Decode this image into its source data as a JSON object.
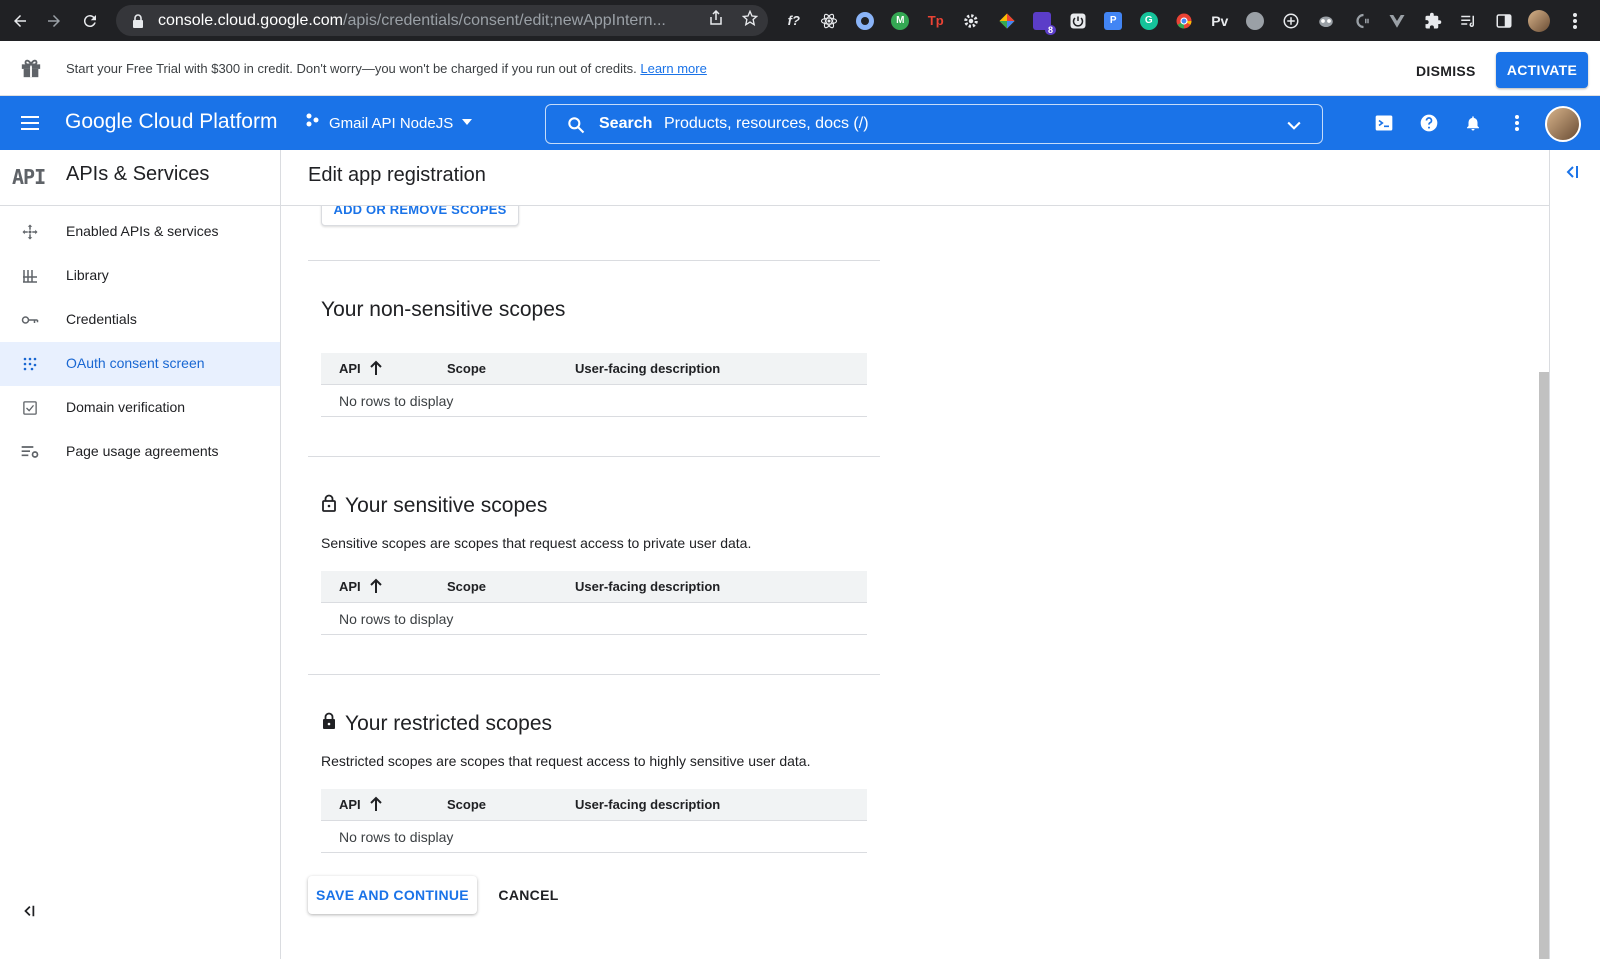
{
  "browser": {
    "url_host": "console.cloud.google.com",
    "url_path": "/apis/credentials/consent/edit;newAppIntern...",
    "extension_badge": "8",
    "ext_labels": {
      "f": "f?",
      "tp": "Tp",
      "pv": "Pv",
      "p": "P",
      "g": "G"
    }
  },
  "trial_banner": {
    "message": "Start your Free Trial with $300 in credit. Don't worry—you won't be charged if you run out of credits.",
    "learn_more": "Learn more",
    "dismiss": "DISMISS",
    "activate": "ACTIVATE"
  },
  "header": {
    "title": "Google Cloud Platform",
    "project": "Gmail API NodeJS",
    "search_label": "Search",
    "search_placeholder": "Products, resources, docs (/)",
    "brand_color": "#1a73e8"
  },
  "sidebar": {
    "logo": "API",
    "title": "APIs & Services",
    "items": [
      {
        "label": "Enabled APIs & services",
        "icon": "apis-hub-icon"
      },
      {
        "label": "Library",
        "icon": "library-icon"
      },
      {
        "label": "Credentials",
        "icon": "key-icon"
      },
      {
        "label": "OAuth consent screen",
        "icon": "consent-grid-icon",
        "active": true
      },
      {
        "label": "Domain verification",
        "icon": "checkbox-icon"
      },
      {
        "label": "Page usage agreements",
        "icon": "settings-list-icon"
      }
    ]
  },
  "main": {
    "page_title": "Edit app registration",
    "add_scopes_button": "ADD OR REMOVE SCOPES",
    "sections": [
      {
        "title": "Your non-sensitive scopes",
        "description": "",
        "columns": [
          "API",
          "Scope",
          "User-facing description"
        ],
        "empty_text": "No rows to display"
      },
      {
        "title": "Your sensitive scopes",
        "description": "Sensitive scopes are scopes that request access to private user data.",
        "columns": [
          "API",
          "Scope",
          "User-facing description"
        ],
        "empty_text": "No rows to display"
      },
      {
        "title": "Your restricted scopes",
        "description": "Restricted scopes are scopes that request access to highly sensitive user data.",
        "columns": [
          "API",
          "Scope",
          "User-facing description"
        ],
        "empty_text": "No rows to display"
      }
    ],
    "save_button": "SAVE AND CONTINUE",
    "cancel_button": "CANCEL"
  }
}
